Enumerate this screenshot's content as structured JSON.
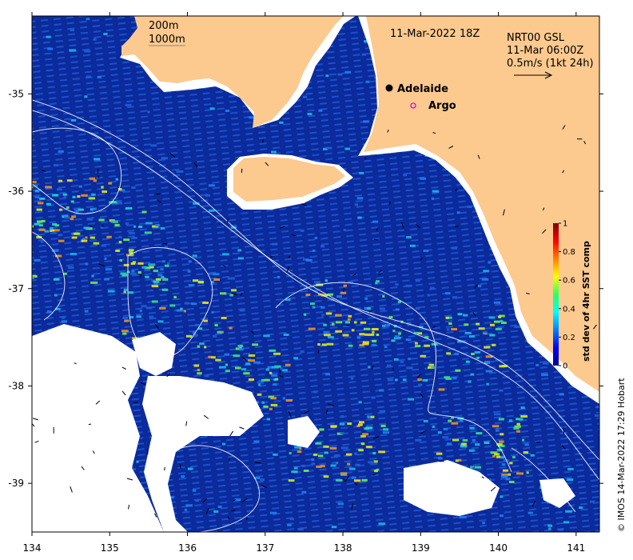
{
  "map": {
    "date_label": "11-Mar-2022 18Z",
    "isobath_shallow": "200m",
    "isobath_deep": "1000m",
    "current_source": "NRT00 GSL",
    "current_time": "11-Mar 06:00Z",
    "current_scale": "0.5m/s (1kt 24h)",
    "credit": "© IMOS 14-Mar-2022 17:29 Hobart",
    "colors": {
      "land": "#fcc98f",
      "ocean": "#0b2a9c",
      "cloud": "#ffffff"
    }
  },
  "places": [
    {
      "name": "Adelaide",
      "marker": "filled-dot",
      "color": "#000000",
      "lon": 138.6,
      "lat": -34.93
    },
    {
      "name": "Argo",
      "marker": "open-circle",
      "color": "#e000e0",
      "lon": 138.9,
      "lat": -35.12
    }
  ],
  "axes": {
    "x_ticks": [
      "134",
      "135",
      "136",
      "137",
      "138",
      "139",
      "140",
      "141"
    ],
    "y_ticks": [
      "-35",
      "-36",
      "-37",
      "-38",
      "-39"
    ],
    "lon_range": [
      134,
      141.3
    ],
    "lat_range": [
      -39.5,
      -34.2
    ]
  },
  "colorbar": {
    "label": "std dev of 4hr SST comp",
    "ticks": [
      "0",
      "0.2",
      "0.4",
      "0.6",
      "0.8",
      "1"
    ],
    "range": [
      0,
      1
    ],
    "colormap": "jet"
  }
}
